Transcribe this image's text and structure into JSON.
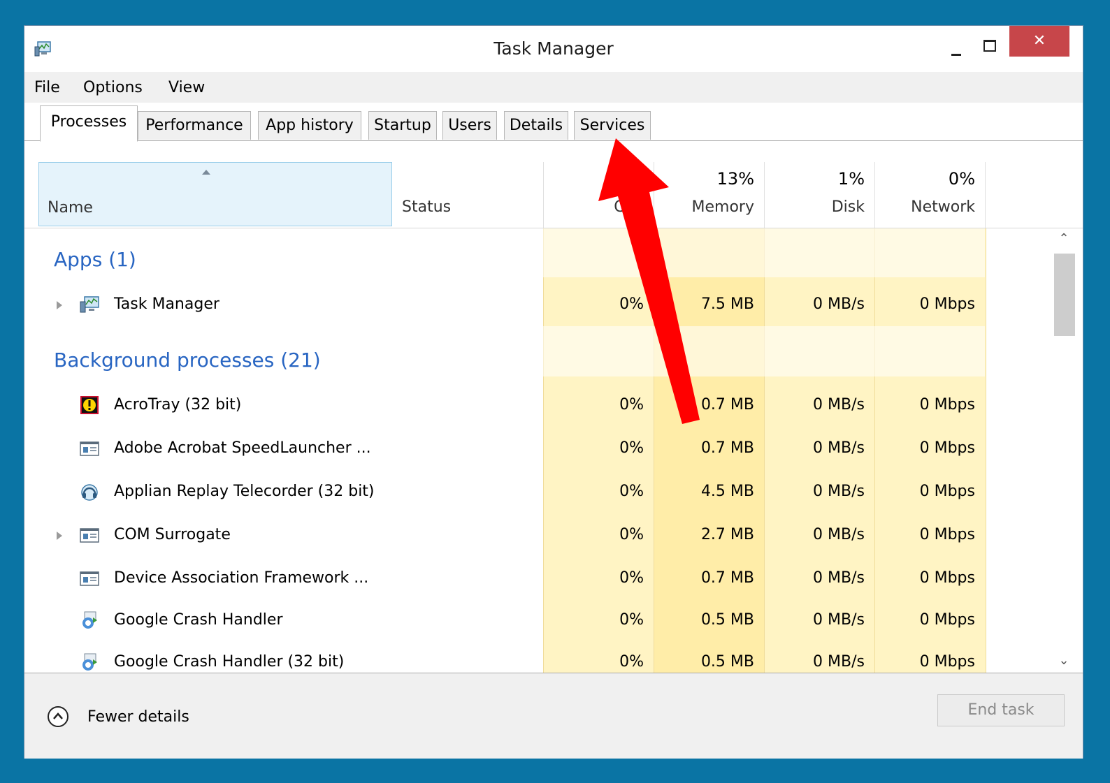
{
  "window": {
    "title": "Task Manager",
    "close_glyph": "✕"
  },
  "menu": [
    "File",
    "Options",
    "View"
  ],
  "tabs": [
    "Processes",
    "Performance",
    "App history",
    "Startup",
    "Users",
    "Details",
    "Services"
  ],
  "columns": {
    "name": "Name",
    "status": "Status",
    "cpu": "CPU",
    "memory": {
      "label": "Memory",
      "pct": "13%"
    },
    "disk": {
      "label": "Disk",
      "pct": "1%"
    },
    "network": {
      "label": "Network",
      "pct": "0%"
    }
  },
  "groups": {
    "apps": "Apps (1)",
    "background": "Background processes (21)"
  },
  "rows": [
    {
      "name": "Task Manager",
      "icon": "task-manager-icon",
      "cpu": "0%",
      "memory": "7.5 MB",
      "disk": "0 MB/s",
      "network": "0 Mbps"
    },
    {
      "name": "AcroTray (32 bit)",
      "icon": "acrotray-icon",
      "cpu": "0%",
      "memory": "0.7 MB",
      "disk": "0 MB/s",
      "network": "0 Mbps"
    },
    {
      "name": "Adobe Acrobat SpeedLauncher ...",
      "icon": "app-window-icon",
      "cpu": "0%",
      "memory": "0.7 MB",
      "disk": "0 MB/s",
      "network": "0 Mbps"
    },
    {
      "name": "Applian Replay Telecorder (32 bit)",
      "icon": "headphones-icon",
      "cpu": "0%",
      "memory": "4.5 MB",
      "disk": "0 MB/s",
      "network": "0 Mbps"
    },
    {
      "name": "COM Surrogate",
      "icon": "app-window-icon",
      "cpu": "0%",
      "memory": "2.7 MB",
      "disk": "0 MB/s",
      "network": "0 Mbps"
    },
    {
      "name": "Device Association Framework ...",
      "icon": "app-window-icon",
      "cpu": "0%",
      "memory": "0.7 MB",
      "disk": "0 MB/s",
      "network": "0 Mbps"
    },
    {
      "name": "Google Crash Handler",
      "icon": "google-update-icon",
      "cpu": "0%",
      "memory": "0.5 MB",
      "disk": "0 MB/s",
      "network": "0 Mbps"
    },
    {
      "name": "Google Crash Handler (32 bit)",
      "icon": "google-update-icon",
      "cpu": "0%",
      "memory": "0.5 MB",
      "disk": "0 MB/s",
      "network": "0 Mbps"
    }
  ],
  "footer": {
    "fewer_details": "Fewer details",
    "end_task": "End task"
  },
  "colors": {
    "accent_blue": "#2865c2",
    "heat_light": "#fff4c4",
    "heat_mid": "#ffe9a0",
    "close_red": "#c7464a",
    "annotation_arrow": "#ff0000"
  }
}
